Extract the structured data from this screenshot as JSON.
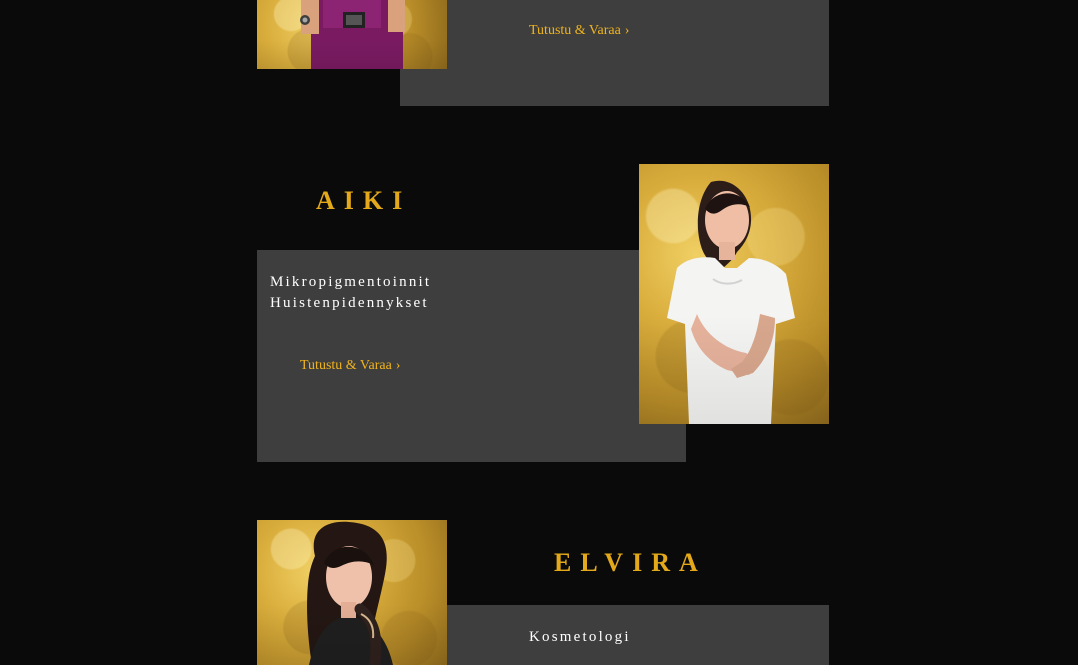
{
  "cards": [
    {
      "cta_label": "Tutustu & Varaa",
      "arrow": "›"
    },
    {
      "name": "AIKI",
      "services": [
        "Mikropigmentoinnit",
        "Huistenpidennykset"
      ],
      "cta_label": "Tutustu & Varaa",
      "arrow": "›"
    },
    {
      "name": "ELVIRA",
      "services": [
        "Kosmetologi"
      ]
    }
  ]
}
